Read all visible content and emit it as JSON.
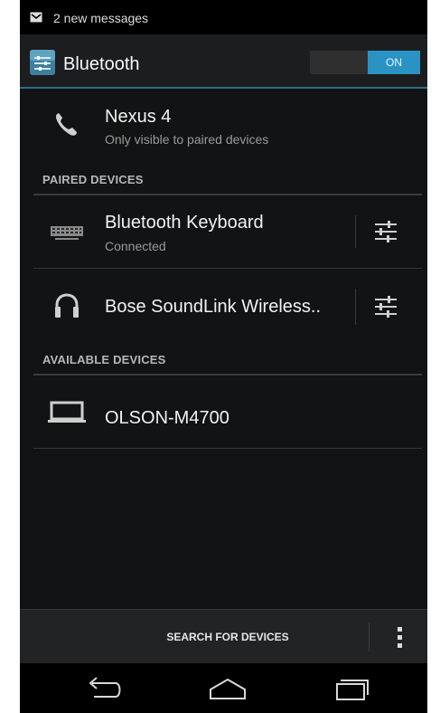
{
  "status_bar": {
    "notification_text": "2 new messages",
    "icon": "mail-icon"
  },
  "action_bar": {
    "title": "Bluetooth",
    "app_icon": "bluetooth-settings-icon",
    "toggle_label": "ON",
    "accent": "#2a93c4"
  },
  "this_device": {
    "name": "Nexus 4",
    "subtitle": "Only visible to paired devices",
    "icon": "phone-icon"
  },
  "paired_section": {
    "header": "PAIRED DEVICES",
    "devices": [
      {
        "name": "Bluetooth  Keyboard",
        "status": "Connected",
        "icon": "keyboard-icon"
      },
      {
        "name": "Bose SoundLink Wireless..",
        "status": "",
        "icon": "headphones-icon"
      }
    ]
  },
  "available_section": {
    "header": "AVAILABLE DEVICES",
    "devices": [
      {
        "name": "OLSON-M4700",
        "icon": "laptop-icon"
      }
    ]
  },
  "bottom_bar": {
    "search_label": "SEARCH FOR DEVICES",
    "overflow_icon": "overflow-menu-icon"
  },
  "nav_bar": {
    "back_icon": "back-icon",
    "home_icon": "home-icon",
    "recents_icon": "recents-icon"
  }
}
